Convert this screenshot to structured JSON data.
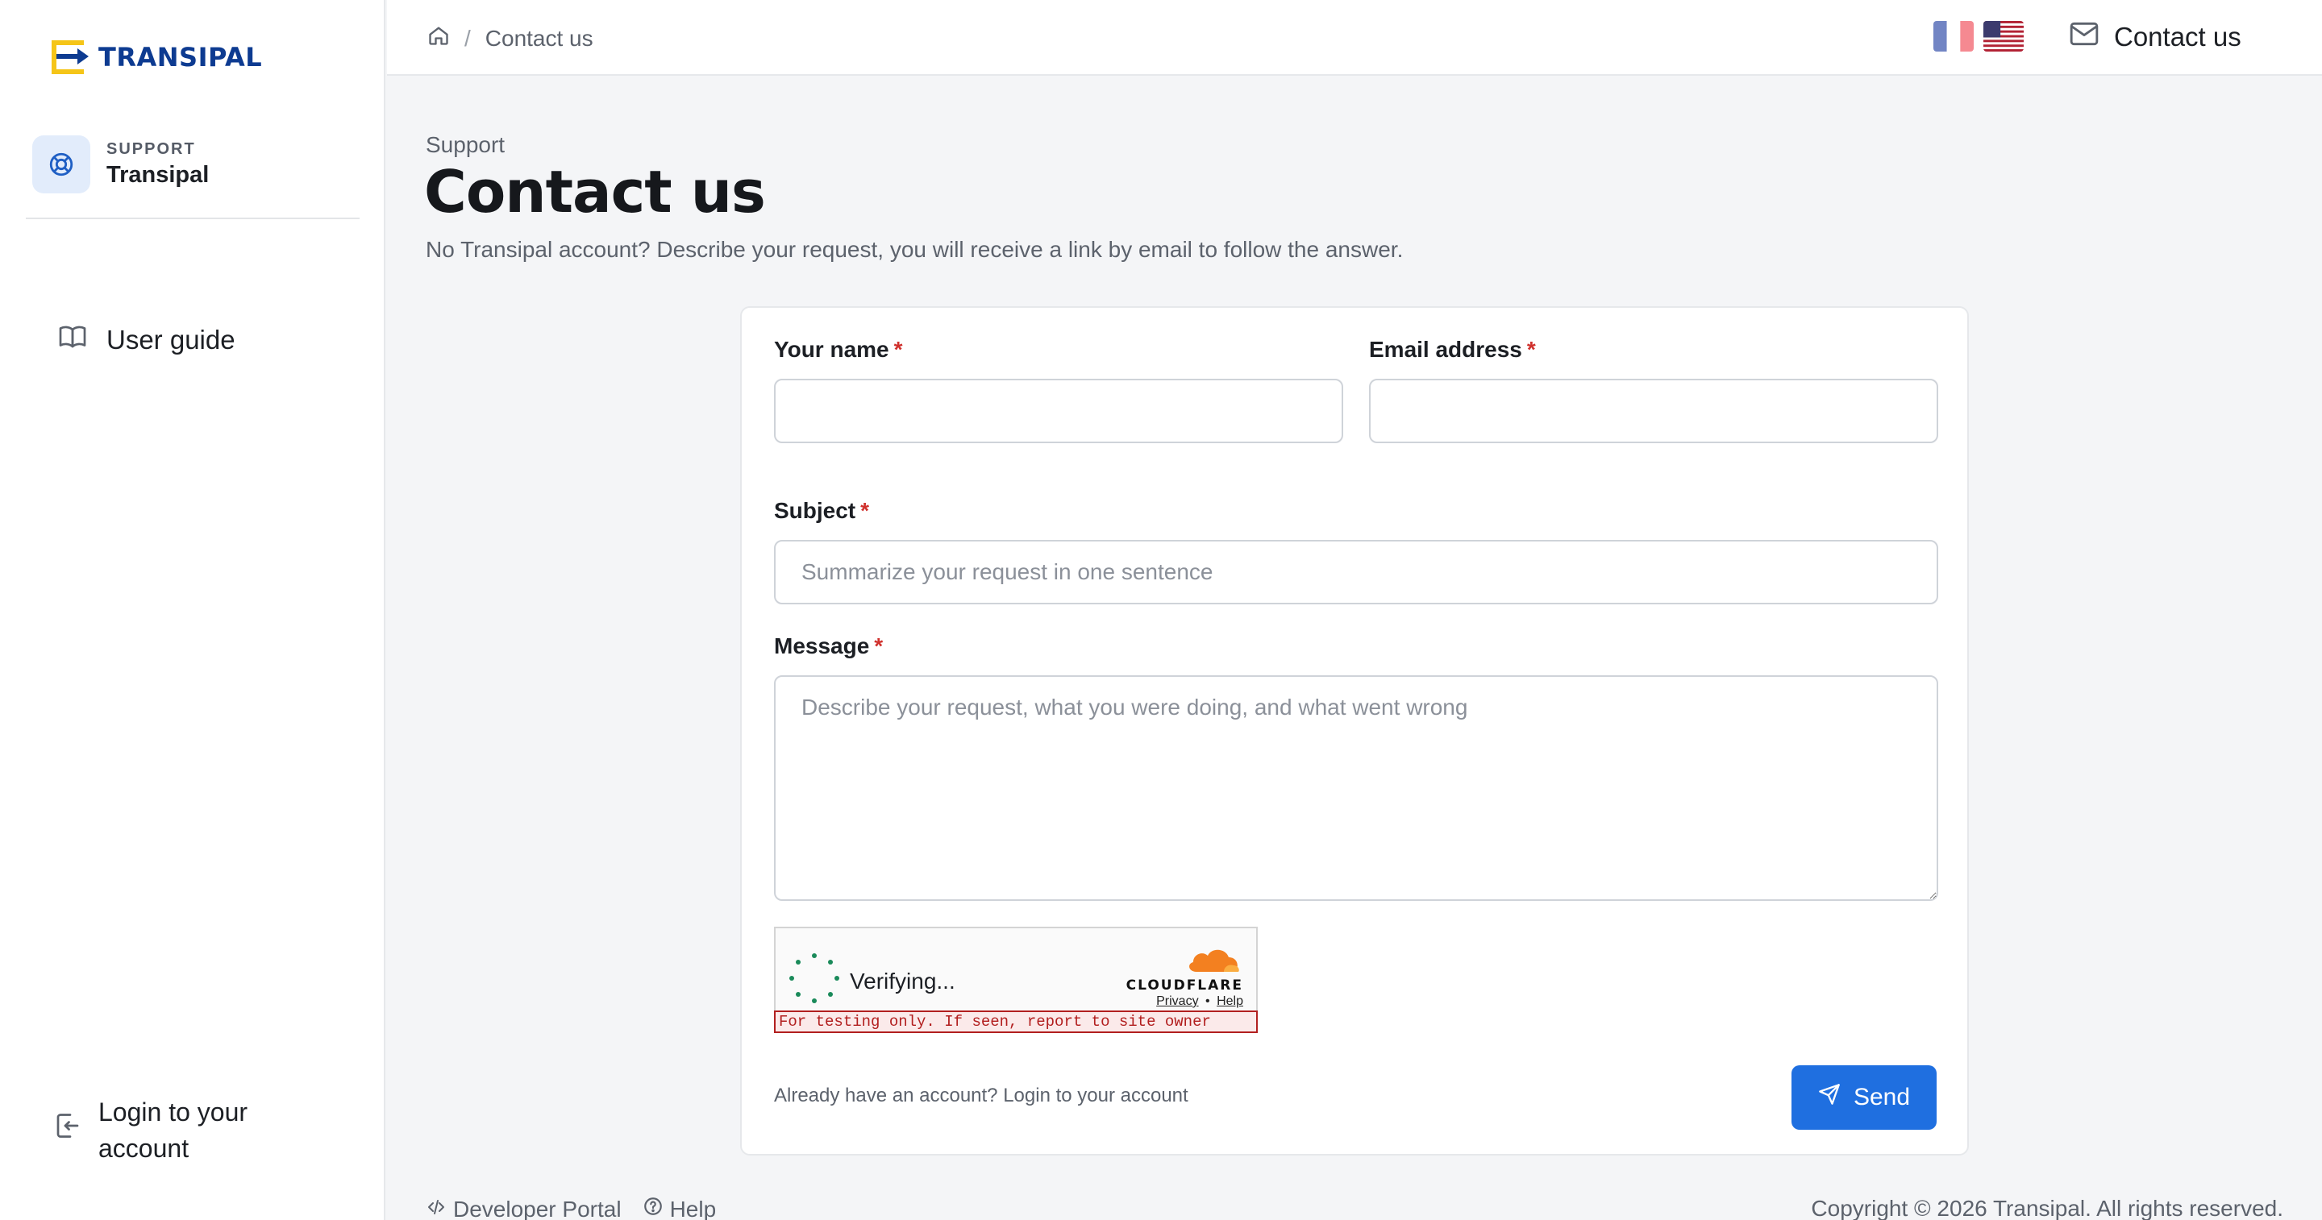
{
  "brand": {
    "name": "TRANSIPAL",
    "color": "#0d3b91",
    "accent": "#f5c518"
  },
  "sidebar": {
    "org_label": "SUPPORT",
    "org_name": "Transipal",
    "items": [
      {
        "label": "User guide",
        "icon": "book-icon"
      }
    ],
    "login": {
      "label": "Login to your account",
      "icon": "login-icon"
    }
  },
  "topbar": {
    "breadcrumb": {
      "home_icon": "home-icon",
      "separator": "/",
      "current": "Contact us"
    },
    "languages": [
      "French",
      "English (US)"
    ],
    "contact": {
      "label": "Contact us",
      "icon": "mail-icon"
    }
  },
  "page": {
    "eyebrow": "Support",
    "title": "Contact us",
    "description": "No Transipal account? Describe your request, you will receive a link by email to follow the answer."
  },
  "form": {
    "required_mark": "*",
    "name": {
      "label": "Your name",
      "value": "",
      "placeholder": ""
    },
    "email": {
      "label": "Email address",
      "value": "",
      "placeholder": ""
    },
    "subject": {
      "label": "Subject",
      "value": "",
      "placeholder": "Summarize your request in one sentence"
    },
    "message": {
      "label": "Message",
      "value": "",
      "placeholder": "Describe your request, what you were doing, and what went wrong"
    },
    "captcha": {
      "status": "Verifying...",
      "provider": "CLOUDFLARE",
      "privacy": "Privacy",
      "dot": "•",
      "help": "Help",
      "warning": "For testing only. If seen, report to site owner"
    },
    "login_prompt": "Already have an account? Login to your account",
    "send_label": "Send",
    "send_color": "#1f6fe0"
  },
  "footer": {
    "developer_portal": "Developer Portal",
    "help": "Help",
    "copyright": "Copyright © 2026 Transipal. All rights reserved."
  }
}
